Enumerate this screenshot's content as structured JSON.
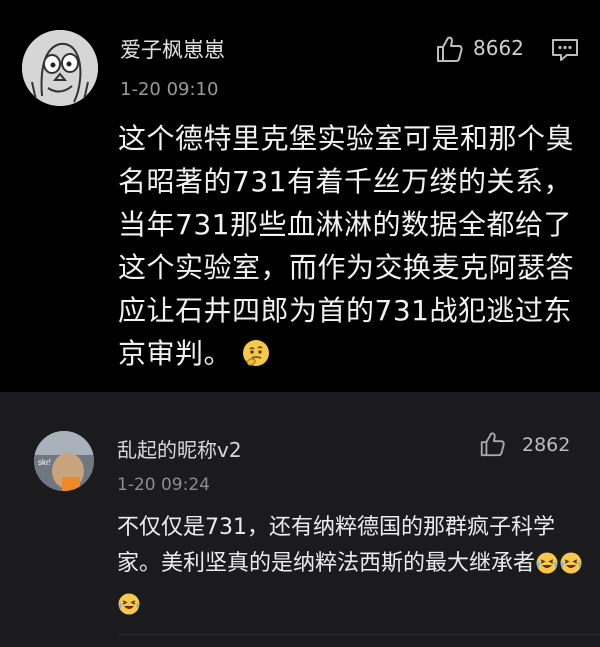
{
  "comments": [
    {
      "username": "爱子枫崽崽",
      "time": "1-20 09:10",
      "likes": "8662",
      "text": "这个德特里克堡实验室可是和那个臭名昭著的731有着千丝万缕的关系，当年731那些血淋淋的数据全都给了这个实验室，而作为交换麦克阿瑟答应让石井四郎为首的731战犯逃过东京审判。",
      "emojis": [
        "thinking-emoji"
      ],
      "avatar_icon": "doodle-face-avatar",
      "colors": {
        "background": "#000000",
        "text": "#f2f2f2",
        "meta": "#9a9a9a"
      }
    },
    {
      "username": "乱起的昵称v2",
      "time": "1-20 09:24",
      "likes": "2862",
      "text": "不仅仅是731，还有纳粹德国的那群疯子科学家。美利坚真的是纳粹法西斯的最大继承者",
      "emojis": [
        "laughing-crying-emoji",
        "laughing-crying-emoji",
        "laughing-crying-emoji"
      ],
      "avatar_icon": "photo-avatar",
      "avatar_text": "skr!",
      "colors": {
        "background": "#1b1b1d",
        "text": "#ececec",
        "meta": "#8d8d8d"
      }
    }
  ]
}
